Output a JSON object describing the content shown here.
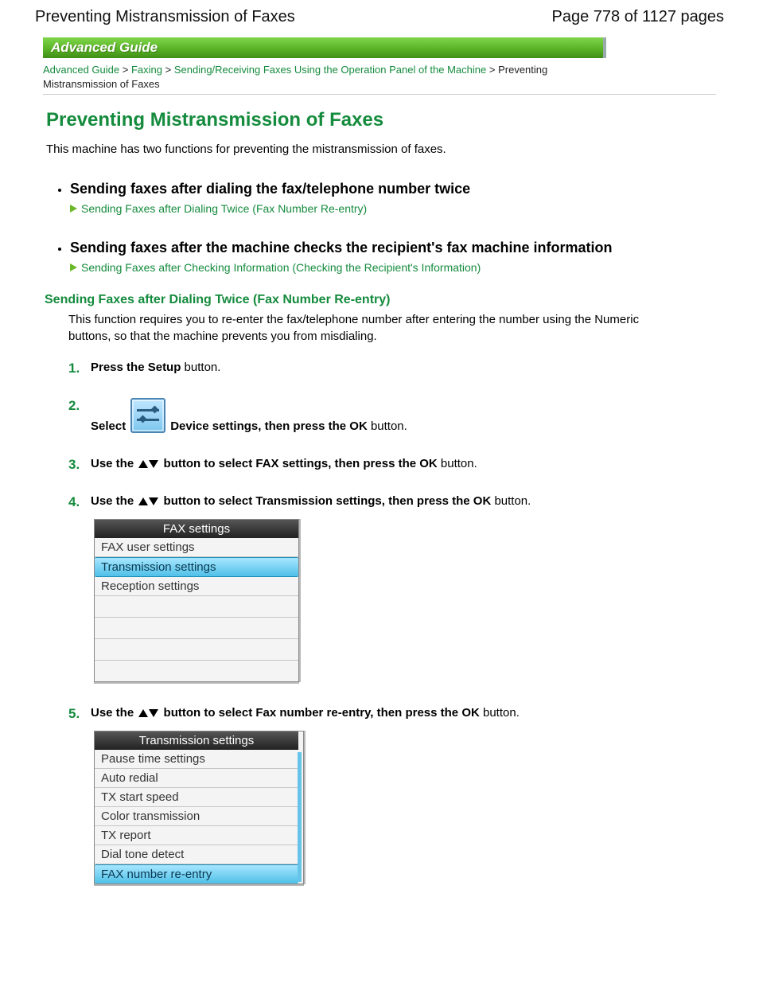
{
  "header": {
    "doc_title": "Preventing Mistransmission of Faxes",
    "page_indicator": "Page 778 of 1127 pages"
  },
  "banner": "Advanced Guide",
  "breadcrumb": {
    "items": [
      {
        "label": "Advanced Guide",
        "link": true
      },
      {
        "label": "Faxing",
        "link": true
      },
      {
        "label": "Sending/Receiving Faxes Using the Operation Panel of the Machine",
        "link": true
      },
      {
        "label": "Preventing Mistransmission of Faxes",
        "link": false
      }
    ],
    "sep": " > "
  },
  "title": "Preventing Mistransmission of Faxes",
  "intro": "This machine has two functions for preventing the mistransmission of faxes.",
  "features": [
    {
      "title": "Sending faxes after dialing the fax/telephone number twice",
      "link_label": "Sending Faxes after Dialing Twice (Fax Number Re-entry)"
    },
    {
      "title": "Sending faxes after the machine checks the recipient's fax machine information",
      "link_label": "Sending Faxes after Checking Information (Checking the Recipient's Information)"
    }
  ],
  "section": {
    "heading": "Sending Faxes after Dialing Twice (Fax Number Re-entry)",
    "desc": "This function requires you to re-enter the fax/telephone number after entering the number using the Numeric buttons, so that the machine prevents you from misdialing."
  },
  "steps": {
    "s1": {
      "a": "Press the ",
      "b": "Setup",
      "c": " button."
    },
    "s2": {
      "a": "Select",
      "b": "Device settings, then press the ",
      "c": "OK",
      "d": " button."
    },
    "s3": {
      "a": "Use the ",
      "b": "button to select FAX settings, then press the ",
      "c": "OK",
      "d": " button."
    },
    "s4": {
      "a": "Use the ",
      "b": "button to select Transmission settings, then press the ",
      "c": "OK",
      "d": " button."
    },
    "s5": {
      "a": "Use the ",
      "b": "button to select Fax number re-entry, then press the ",
      "c": "OK",
      "d": " button."
    }
  },
  "lcd1": {
    "title": "FAX settings",
    "rows": [
      {
        "label": "FAX user settings",
        "selected": false
      },
      {
        "label": "Transmission settings",
        "selected": true
      },
      {
        "label": "Reception settings",
        "selected": false
      }
    ]
  },
  "lcd2": {
    "title": "Transmission settings",
    "rows": [
      {
        "label": "Pause time settings",
        "selected": false
      },
      {
        "label": "Auto redial",
        "selected": false
      },
      {
        "label": "TX start speed",
        "selected": false
      },
      {
        "label": "Color transmission",
        "selected": false
      },
      {
        "label": "TX report",
        "selected": false
      },
      {
        "label": "Dial tone detect",
        "selected": false
      },
      {
        "label": "FAX number re-entry",
        "selected": true
      }
    ]
  }
}
